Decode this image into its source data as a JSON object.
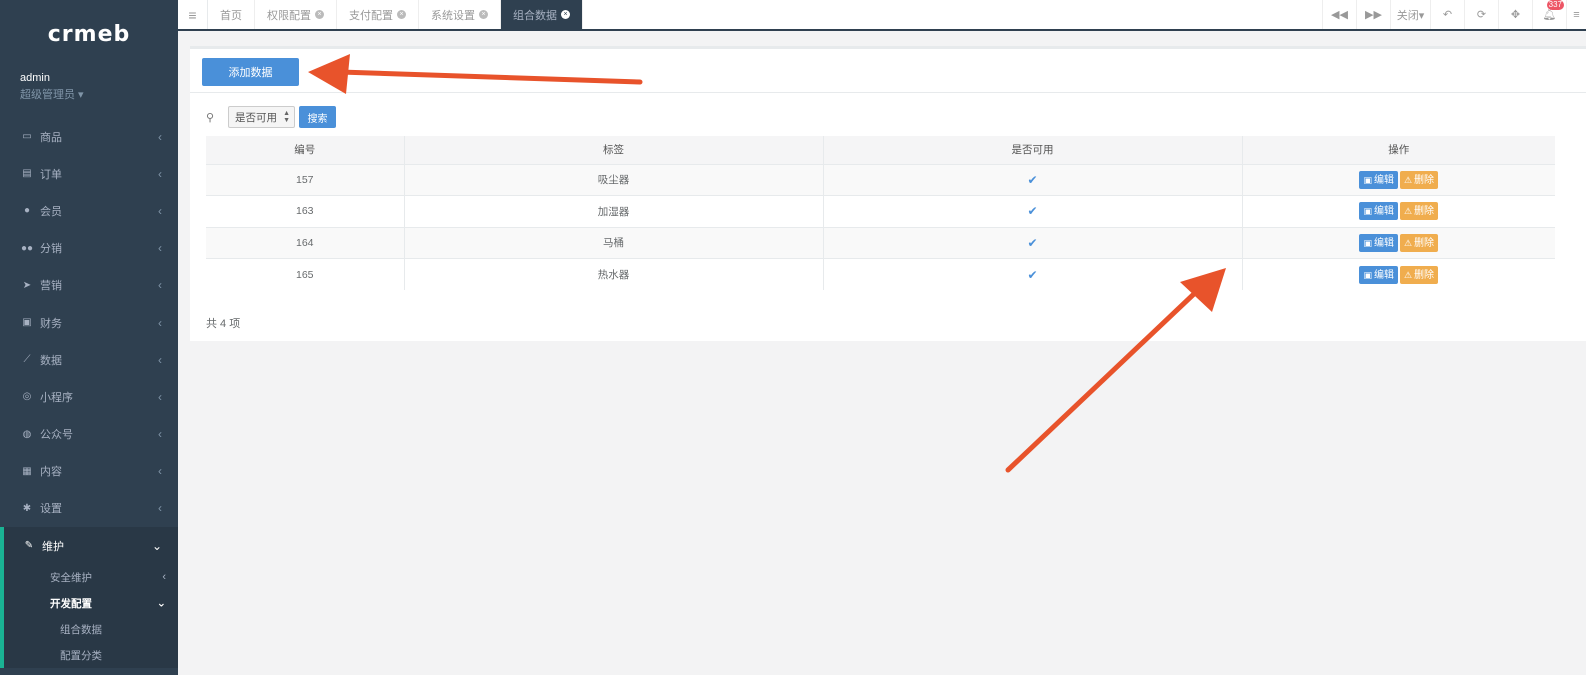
{
  "brand": {
    "logo_text": "crmeb"
  },
  "profile": {
    "name": "admin",
    "role": "超级管理员 ▾"
  },
  "sidebar": {
    "items": [
      {
        "label": "商品",
        "icon": "desktop-icon"
      },
      {
        "label": "订单",
        "icon": "clipboard-icon"
      },
      {
        "label": "会员",
        "icon": "user-icon"
      },
      {
        "label": "分销",
        "icon": "users-icon"
      },
      {
        "label": "营销",
        "icon": "paper-plane-icon"
      },
      {
        "label": "财务",
        "icon": "money-icon"
      },
      {
        "label": "数据",
        "icon": "line-chart-icon"
      },
      {
        "label": "小程序",
        "icon": "bicycle-icon"
      },
      {
        "label": "公众号",
        "icon": "wechat-icon"
      },
      {
        "label": "内容",
        "icon": "newspaper-icon"
      },
      {
        "label": "设置",
        "icon": "gear-icon"
      },
      {
        "label": "维护",
        "icon": "wrench-icon"
      }
    ],
    "sub": {
      "safety": "安全维护",
      "dev_config": "开发配置",
      "combo_data": "组合数据",
      "config_category": "配置分类"
    }
  },
  "tabs": [
    "首页",
    "权限配置",
    "支付配置",
    "系统设置",
    "组合数据"
  ],
  "topbar": {
    "close_label": "关闭▾",
    "badge_count": "337"
  },
  "toolbar": {
    "add_label": "添加数据"
  },
  "search": {
    "select_value": "是否可用",
    "button_label": "搜索"
  },
  "table": {
    "headers": [
      "编号",
      "标签",
      "是否可用",
      "操作"
    ],
    "rows": [
      {
        "id": "157",
        "label": "吸尘器",
        "enabled": true
      },
      {
        "id": "163",
        "label": "加湿器",
        "enabled": true
      },
      {
        "id": "164",
        "label": "马桶",
        "enabled": true
      },
      {
        "id": "165",
        "label": "热水器",
        "enabled": true
      }
    ],
    "edit_label": "编辑",
    "delete_label": "删除"
  },
  "footer": {
    "total": "共 4 项"
  },
  "colors": {
    "sidebar": "#2f4050",
    "primary": "#4a90d9",
    "warning": "#f0ad4e",
    "annotation": "#e8532b"
  }
}
